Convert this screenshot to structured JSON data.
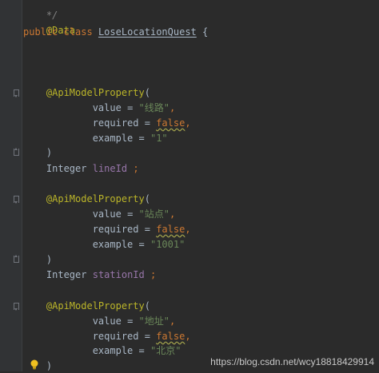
{
  "code": {
    "line_top": "*/",
    "data_annotation": "@Data",
    "class_public": "public",
    "class_kw": "class",
    "class_name": "LoseLocationQuest",
    "class_brace": "{",
    "block1": {
      "annotation": "@ApiModelProperty",
      "open": "(",
      "value_key": "value",
      "eq": "=",
      "value_str": "\"线路\"",
      "required_key": "required",
      "required_val": "false",
      "example_key": "example",
      "example_str": "\"1\"",
      "close": ")",
      "type": "Integer",
      "field": "lineId",
      "semi": ";"
    },
    "block2": {
      "annotation": "@ApiModelProperty",
      "open": "(",
      "value_key": "value",
      "eq": "=",
      "value_str": "\"站点\"",
      "required_key": "required",
      "required_val": "false",
      "example_key": "example",
      "example_str": "\"1001\"",
      "close": ")",
      "type": "Integer",
      "field": "stationId",
      "semi": ";"
    },
    "block3": {
      "annotation": "@ApiModelProperty",
      "open": "(",
      "value_key": "value",
      "eq": "=",
      "value_str": "\"地址\"",
      "required_key": "required",
      "required_val": "false",
      "example_key": "example",
      "example_str": "\"北京\"",
      "close": ")"
    },
    "comma": ","
  },
  "watermark": "https://blog.csdn.net/wcy18818429914",
  "icons": [
    "fold-marker-icon",
    "lightbulb-icon"
  ],
  "colors": {
    "background": "#2b2b2b",
    "keyword": "#cc7832",
    "annotation": "#bbb529",
    "string": "#6a8759",
    "field": "#9876aa",
    "text": "#a9b7c6"
  }
}
